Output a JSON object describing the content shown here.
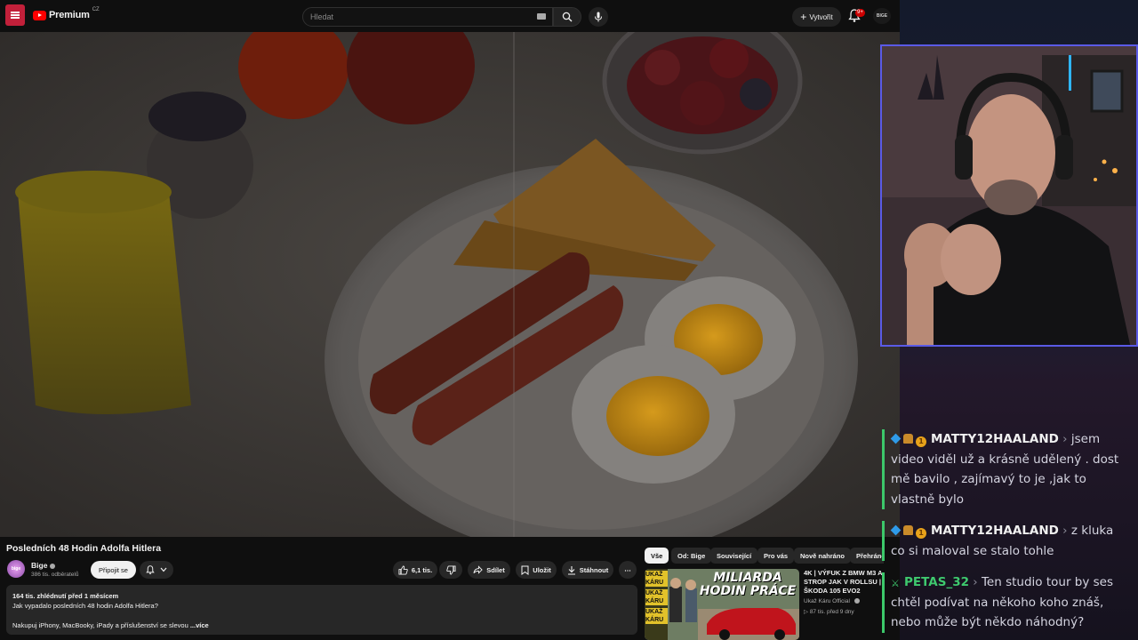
{
  "topbar": {
    "logo_text": "Premium",
    "logo_region": "CZ",
    "search_placeholder": "Hledat",
    "create_label": "Vytvořit",
    "notification_count": "9+",
    "avatar_text": "BIGE"
  },
  "video": {
    "title": "Posledních 48 Hodin Adolfa Hitlera",
    "channel_name": "Bige",
    "channel_avatar_text": "bige",
    "subscribers": "386 tis. odběratelů",
    "join_label": "Připojit se",
    "likes": "6,1 tis.",
    "share_label": "Sdílet",
    "save_label": "Uložit",
    "download_label": "Stáhnout",
    "more_label": "⋯"
  },
  "description": {
    "meta": "164 tis. zhlédnutí  před 1 měsícem",
    "line1": "Jak vypadalo posledních 48 hodin Adolfa Hitlera?",
    "line2": "Nakupuj iPhony, MacBooky, iPady a příslušenství se slevou",
    "more": "...více"
  },
  "chips": [
    "Vše",
    "Od: Bige",
    "Související",
    "Pro vás",
    "Nově nahráno",
    "Přehráno"
  ],
  "recommendation": {
    "title": "4K | VÝFUK Z BMW M3 A STROP JAK V ROLLSU | ŠKODA 105 EVO2",
    "channel": "Ukaž Káru Official",
    "meta": "87 tis.  před 9 dny",
    "thumb_headline_1": "MILIARDA",
    "thumb_headline_2": "HODIN PRÁCE",
    "thumb_brand": "UKAŽ KÁRU"
  },
  "chat": [
    {
      "user": "MATTY12HAALAND",
      "text": "jsem video viděl už a krásně udělený . dost mě bavilo , zajímavý to je ,jak to vlastně bylo",
      "sep": "›"
    },
    {
      "user": "MATTY12HAALAND",
      "text": "z kluka co si maloval se stalo tohle",
      "sep": "›"
    },
    {
      "user": "PETAS_32",
      "text": "Ten studio tour by ses chtěl podívat na někoho koho znáš, nebo může být někdo náhodný?",
      "sep": "›"
    }
  ]
}
